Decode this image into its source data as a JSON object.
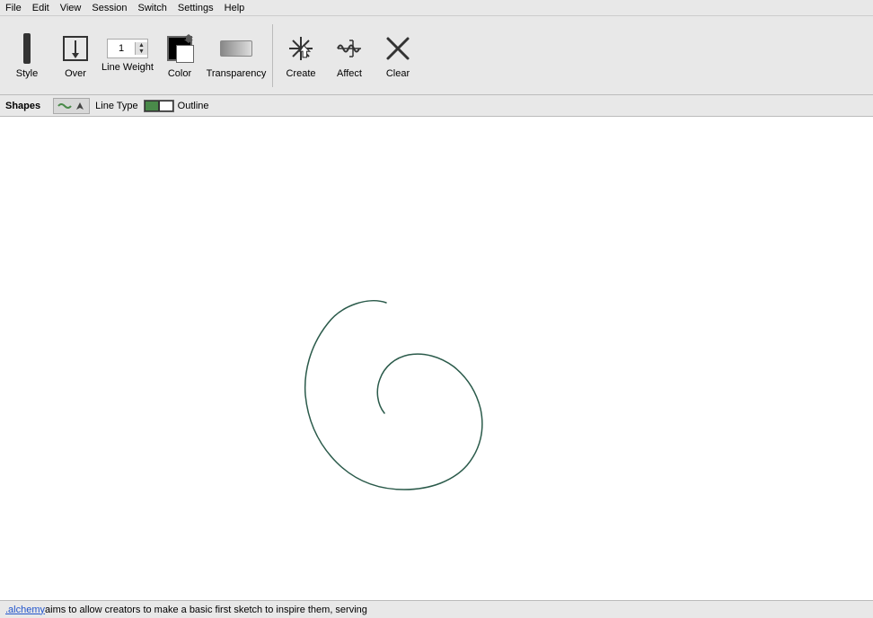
{
  "menu": {
    "items": [
      "File",
      "Edit",
      "View",
      "Session",
      "Switch",
      "Settings",
      "Help"
    ]
  },
  "toolbar": {
    "style": {
      "label": "Style"
    },
    "over": {
      "label": "Over"
    },
    "line_weight": {
      "label": "Line Weight",
      "value": "1"
    },
    "color": {
      "label": "Color"
    },
    "transparency": {
      "label": "Transparency"
    },
    "create": {
      "label": "Create"
    },
    "affect": {
      "label": "Affect"
    },
    "clear": {
      "label": "Clear"
    }
  },
  "shapes_bar": {
    "label": "Shapes",
    "line_type_label": "Line Type",
    "outline_label": "Outline"
  },
  "status_bar": {
    "link_text": ".alchemy",
    "description": " aims to allow creators to make a basic first sketch to inspire them, serving"
  }
}
